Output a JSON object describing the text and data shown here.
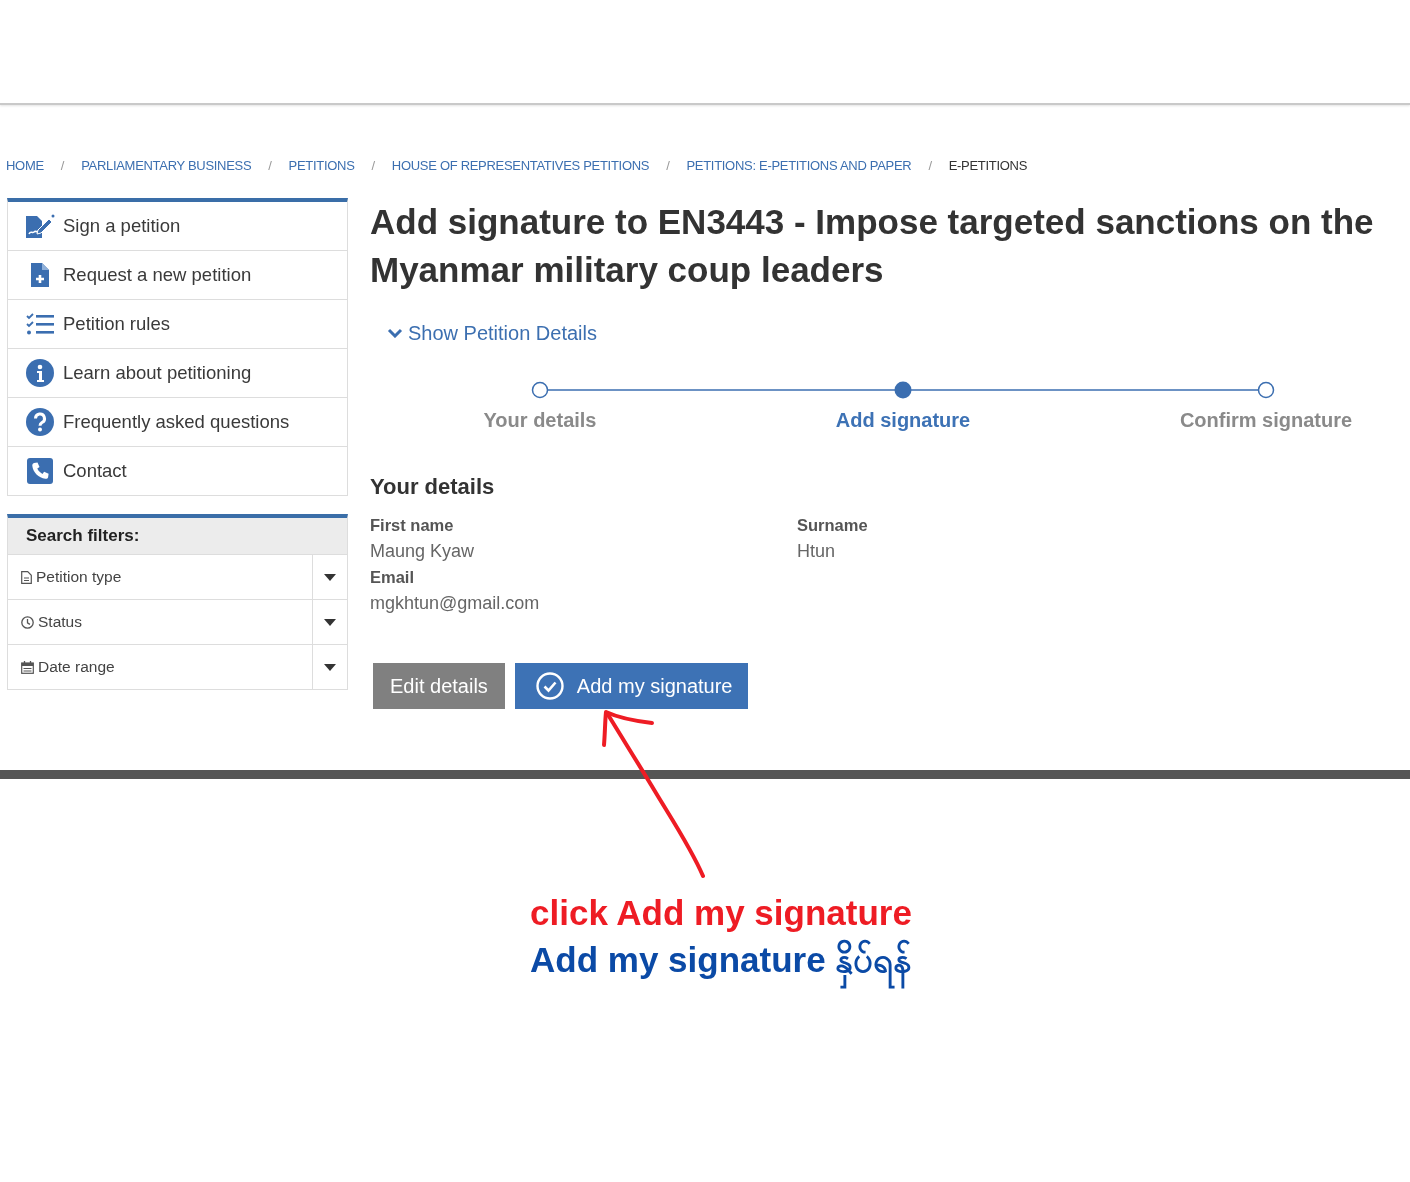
{
  "breadcrumb": {
    "separator": "/",
    "items": [
      {
        "label": "HOME",
        "current": false
      },
      {
        "label": "PARLIAMENTARY BUSINESS",
        "current": false
      },
      {
        "label": "PETITIONS",
        "current": false
      },
      {
        "label": "HOUSE OF REPRESENTATIVES PETITIONS",
        "current": false
      },
      {
        "label": "PETITIONS: E-PETITIONS AND PAPER",
        "current": false
      },
      {
        "label": "E-PETITIONS",
        "current": true
      }
    ]
  },
  "sidebar": {
    "items": [
      {
        "label": "Sign a petition"
      },
      {
        "label": "Request a new petition"
      },
      {
        "label": "Petition rules"
      },
      {
        "label": "Learn about petitioning"
      },
      {
        "label": "Frequently asked questions"
      },
      {
        "label": "Contact"
      }
    ]
  },
  "search_filters": {
    "title": "Search filters:",
    "filters": [
      {
        "label": "Petition type"
      },
      {
        "label": "Status"
      },
      {
        "label": "Date range"
      }
    ]
  },
  "main": {
    "title": "Add signature to EN3443 - Impose targeted sanctions on the Myanmar military coup leaders",
    "details_toggle": {
      "label": "Show Petition Details",
      "expanded": false
    },
    "steps": [
      {
        "label": "Your details",
        "selected": false
      },
      {
        "label": "Add signature",
        "selected": true
      },
      {
        "label": "Confirm signature",
        "selected": false
      }
    ],
    "details": {
      "heading": "Your details",
      "fields": [
        {
          "label": "First name",
          "value": "Maung Kyaw"
        },
        {
          "label": "Surname",
          "value": "Htun"
        },
        {
          "label": "Email",
          "value": "mgkhtun@gmail.com"
        }
      ]
    },
    "buttons": [
      {
        "label": "Edit details",
        "kind": "secondary"
      },
      {
        "label": "Add my signature",
        "kind": "primary"
      }
    ]
  },
  "annotation": {
    "lines": [
      {
        "text": "click Add my signature",
        "color": "#ee1c24"
      },
      {
        "text": "Add my signature နှိပ်ရန်",
        "color": "#0b4aa6"
      }
    ]
  }
}
